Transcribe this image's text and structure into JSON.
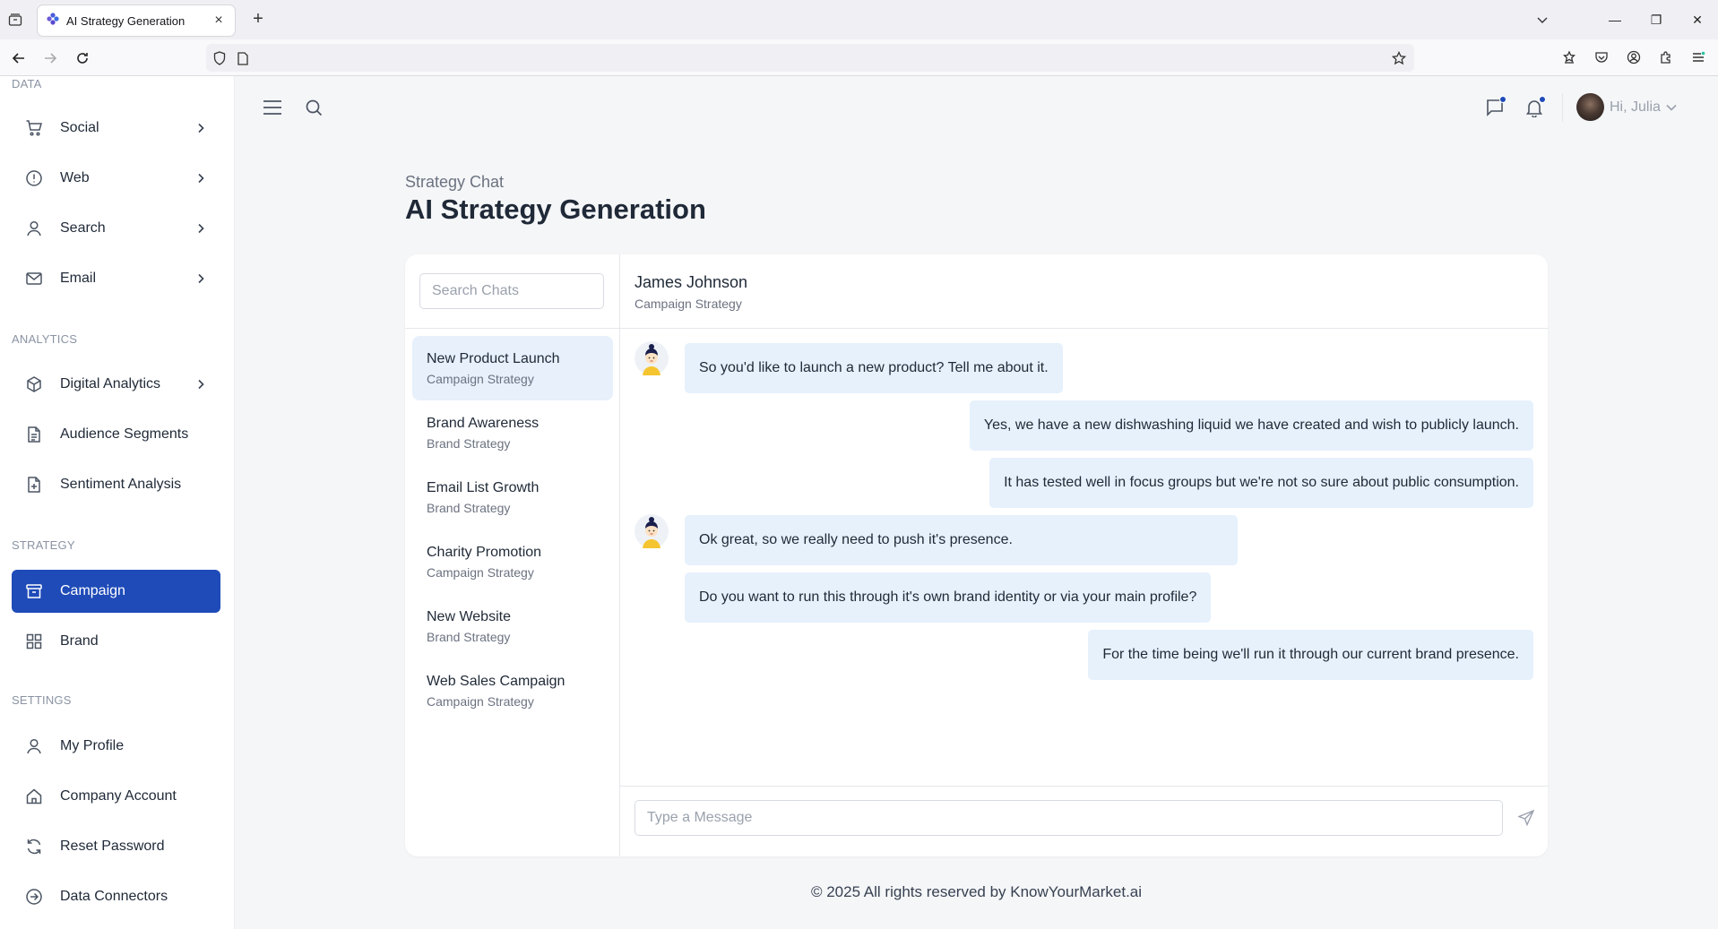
{
  "browser": {
    "tab_title": "AI Strategy Generation"
  },
  "sidebar": {
    "sections": {
      "data": "DATA",
      "analytics": "ANALYTICS",
      "strategy": "STRATEGY",
      "settings": "SETTINGS"
    },
    "items": [
      {
        "label": "Social",
        "icon": "cart-icon",
        "has_chevron": true
      },
      {
        "label": "Web",
        "icon": "alert-circle-icon",
        "has_chevron": true
      },
      {
        "label": "Search",
        "icon": "user-icon",
        "has_chevron": true
      },
      {
        "label": "Email",
        "icon": "mail-icon",
        "has_chevron": true
      },
      {
        "label": "Digital Analytics",
        "icon": "box-icon",
        "has_chevron": true
      },
      {
        "label": "Audience Segments",
        "icon": "document-icon",
        "has_chevron": false
      },
      {
        "label": "Sentiment Analysis",
        "icon": "file-plus-icon",
        "has_chevron": false
      },
      {
        "label": "Campaign",
        "icon": "archive-icon",
        "has_chevron": false,
        "active": true
      },
      {
        "label": "Brand",
        "icon": "grid-icon",
        "has_chevron": false
      },
      {
        "label": "My Profile",
        "icon": "user-icon",
        "has_chevron": false
      },
      {
        "label": "Company Account",
        "icon": "home-icon",
        "has_chevron": false
      },
      {
        "label": "Reset Password",
        "icon": "refresh-icon",
        "has_chevron": false
      },
      {
        "label": "Data Connectors",
        "icon": "arrow-circle-icon",
        "has_chevron": false
      }
    ]
  },
  "header": {
    "greeting": "Hi,  Julia"
  },
  "page": {
    "breadcrumb": "Strategy Chat",
    "title": "AI Strategy Generation"
  },
  "chat_list": {
    "search_placeholder": "Search Chats",
    "conversations": [
      {
        "name": "New Product Launch",
        "type": "Campaign Strategy",
        "active": true
      },
      {
        "name": "Brand Awareness",
        "type": "Brand Strategy"
      },
      {
        "name": "Email List Growth",
        "type": "Brand Strategy"
      },
      {
        "name": "Charity Promotion",
        "type": "Campaign Strategy"
      },
      {
        "name": "New Website",
        "type": "Brand Strategy"
      },
      {
        "name": "Web Sales Campaign",
        "type": "Campaign Strategy"
      }
    ]
  },
  "chat": {
    "contact_name": "James Johnson",
    "contact_subtitle": "Campaign Strategy",
    "messages": [
      {
        "from": "bot",
        "text": "So you'd like to launch a new product? Tell me about it."
      },
      {
        "from": "user",
        "text": "Yes, we have a new dishwashing liquid we have created and wish to publicly launch."
      },
      {
        "from": "user",
        "text": "It has tested well in focus groups but we're not so sure about public consumption."
      },
      {
        "from": "bot",
        "text": "Ok great, so we really need to push it's presence."
      },
      {
        "from": "bot",
        "text": "Do you want to run this through it's own brand identity or via your main profile?"
      },
      {
        "from": "user",
        "text": "For the time being we'll run it through our current brand presence."
      }
    ],
    "input_placeholder": "Type a Message"
  },
  "footer": {
    "text": "© 2025 All rights reserved by KnowYourMarket.ai"
  },
  "colors": {
    "accent": "#1f4bb8",
    "bubble": "#e6f1fc",
    "active_conv": "#e7f0fb"
  }
}
